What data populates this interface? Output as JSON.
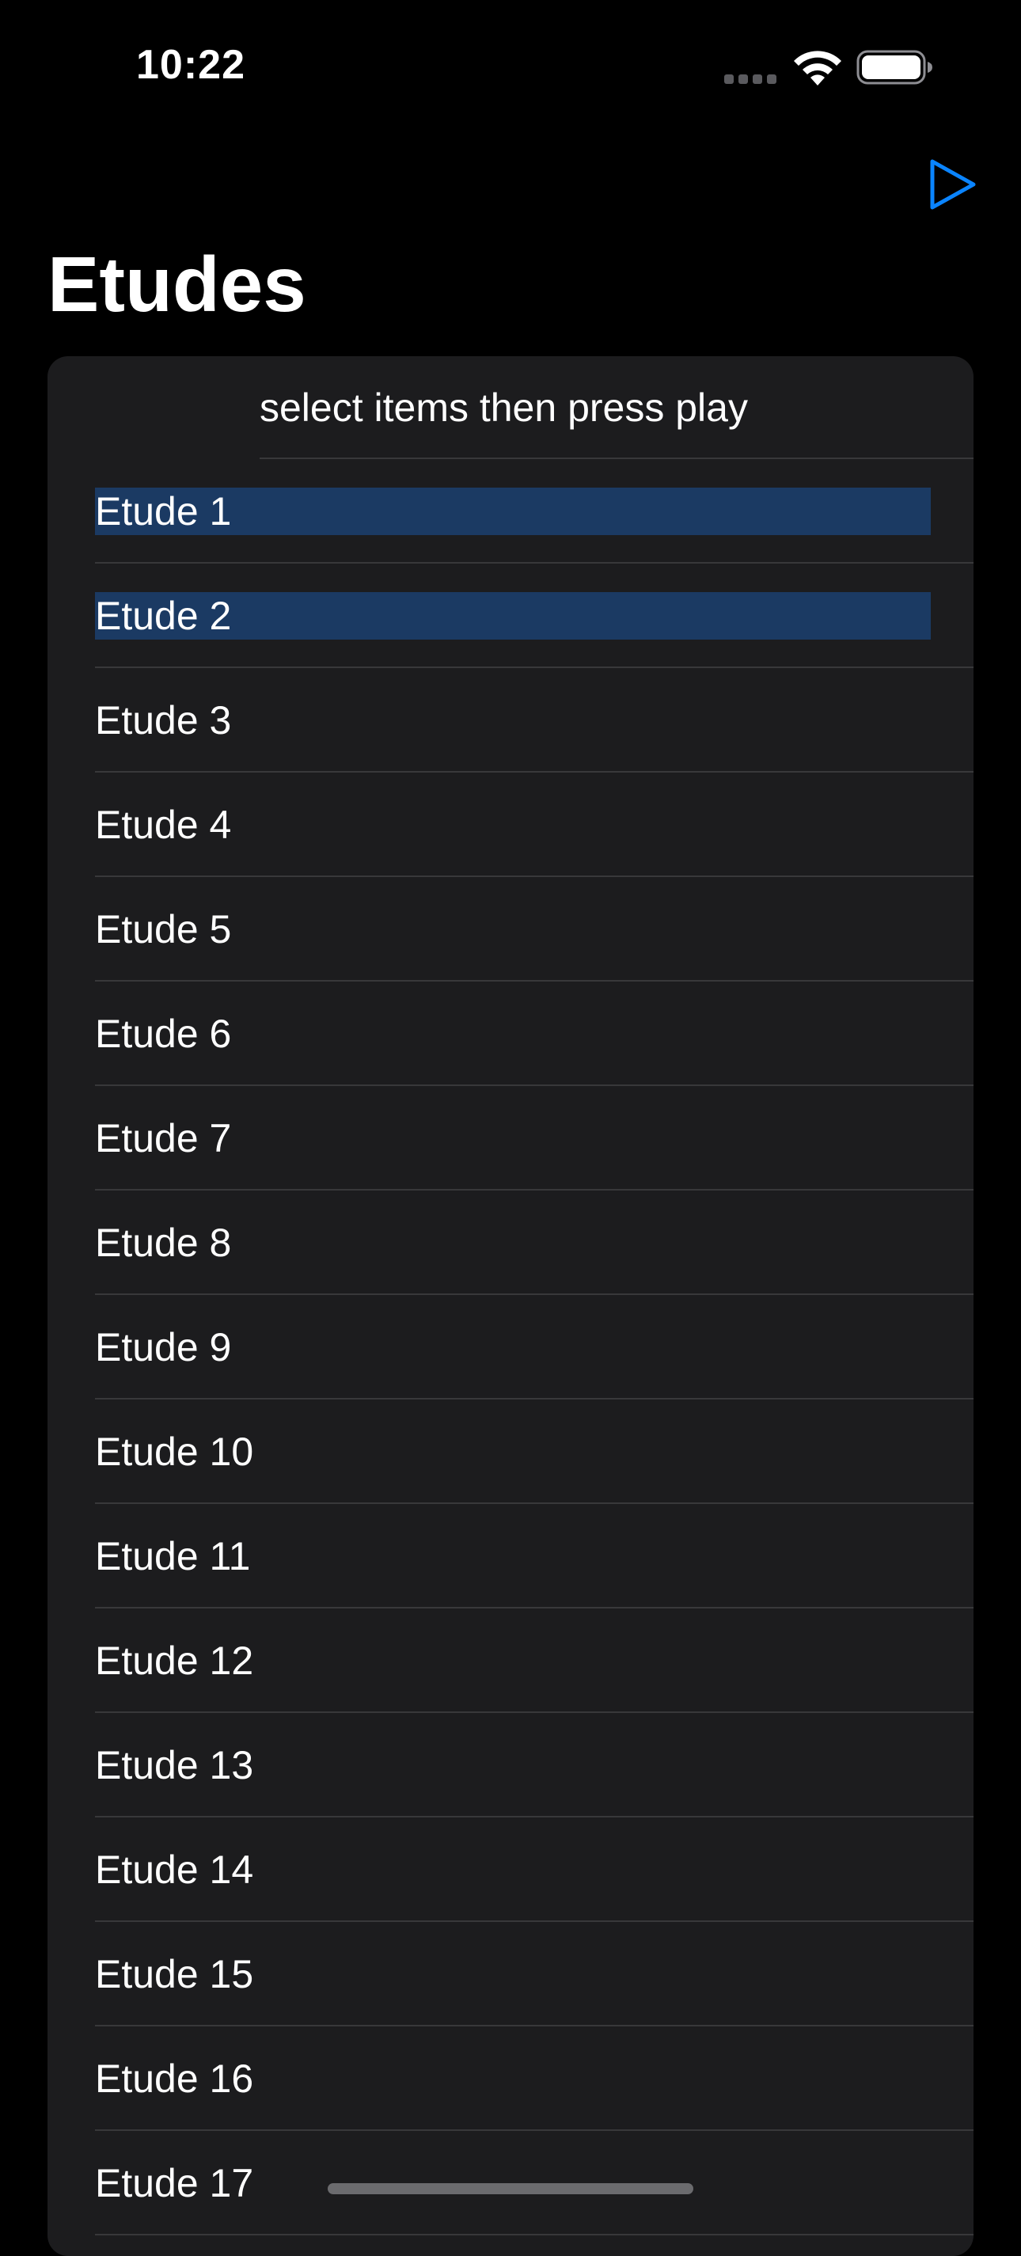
{
  "status_bar": {
    "time": "10:22"
  },
  "nav": {
    "title": "Etudes",
    "play_icon": "play-icon",
    "accent_color": "#0a84ff"
  },
  "list": {
    "header": "select items then press play",
    "items": [
      {
        "label": "Etude 1",
        "selected": true
      },
      {
        "label": "Etude 2",
        "selected": true
      },
      {
        "label": "Etude 3",
        "selected": false
      },
      {
        "label": "Etude 4",
        "selected": false
      },
      {
        "label": "Etude 5",
        "selected": false
      },
      {
        "label": "Etude 6",
        "selected": false
      },
      {
        "label": "Etude 7",
        "selected": false
      },
      {
        "label": "Etude 8",
        "selected": false
      },
      {
        "label": "Etude 9",
        "selected": false
      },
      {
        "label": "Etude 10",
        "selected": false
      },
      {
        "label": "Etude 11",
        "selected": false
      },
      {
        "label": "Etude 12",
        "selected": false
      },
      {
        "label": "Etude 13",
        "selected": false
      },
      {
        "label": "Etude 14",
        "selected": false
      },
      {
        "label": "Etude 15",
        "selected": false
      },
      {
        "label": "Etude 16",
        "selected": false
      },
      {
        "label": "Etude 17",
        "selected": false
      }
    ],
    "selection_color": "#1b3a63"
  }
}
